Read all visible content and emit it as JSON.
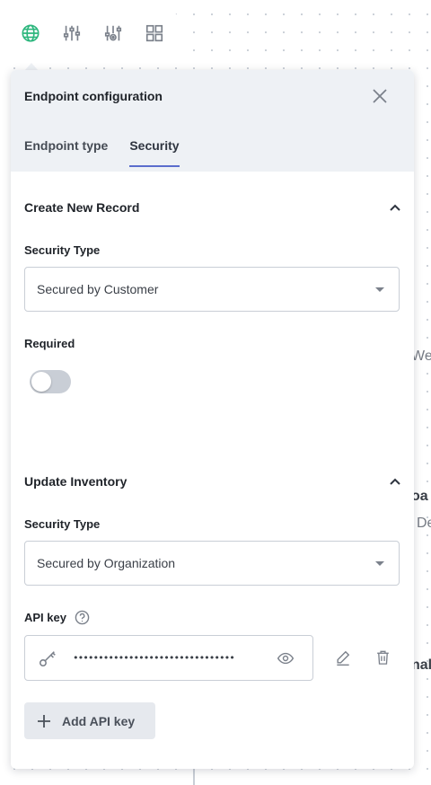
{
  "background": {
    "text_1": "We",
    "text_2": "oa",
    "text_3": "De",
    "text_4": "nal"
  },
  "toolbar": {
    "items": [
      {
        "icon": "globe-icon",
        "active": true
      },
      {
        "icon": "sliders-icon"
      },
      {
        "icon": "sliders-settings-icon"
      },
      {
        "icon": "grid-icon"
      }
    ]
  },
  "panel": {
    "title": "Endpoint configuration",
    "tabs": [
      {
        "label": "Endpoint type",
        "active": false
      },
      {
        "label": "Security",
        "active": true
      }
    ],
    "sections": [
      {
        "title": "Create New Record",
        "security_type_label": "Security Type",
        "security_type_value": "Secured by Customer",
        "required_label": "Required",
        "required": false
      },
      {
        "title": "Update Inventory",
        "security_type_label": "Security Type",
        "security_type_value": "Secured by Organization",
        "api_key_label": "API key",
        "api_key_value": "••••••••••••••••••••••••••••••••",
        "add_api_key_label": "Add API key"
      }
    ]
  },
  "colors": {
    "accent": "#5b6dcd",
    "globe_green": "#2cb67d",
    "header_bg": "#eef1f5",
    "toggle_off": "#c9ced6"
  }
}
